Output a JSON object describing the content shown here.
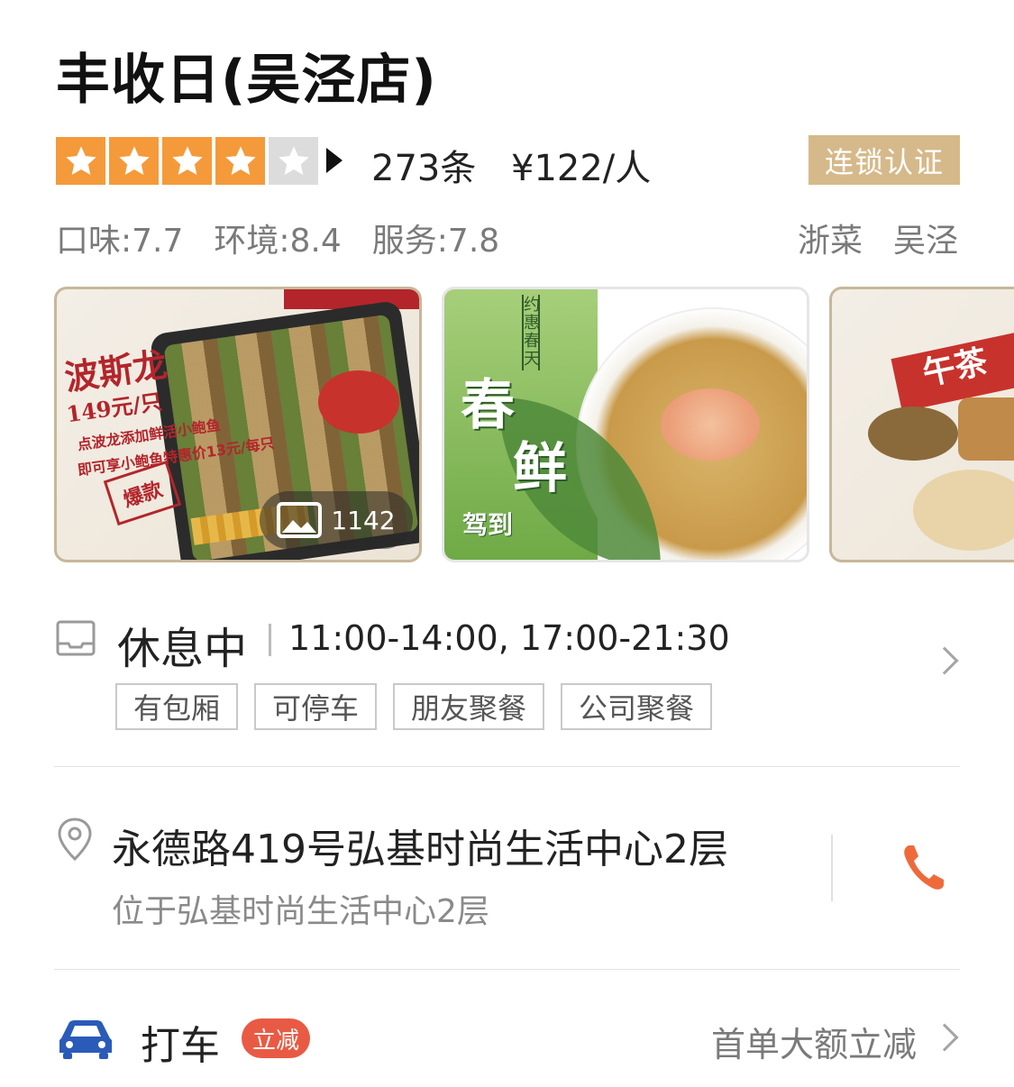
{
  "shop": {
    "title": "丰收日(吴泾店)",
    "rating_stars": 4,
    "review_count": "273条",
    "price_per_person": "¥122/人",
    "chain_badge": "连锁认证",
    "scores": [
      {
        "label": "口味:7.7"
      },
      {
        "label": "环境:8.4"
      },
      {
        "label": "服务:7.8"
      }
    ],
    "tags": [
      "浙菜",
      "吴泾"
    ]
  },
  "gallery": {
    "photo_count": "1142",
    "cards": [
      {
        "title": "波斯龙",
        "price": "149元/只",
        "line1": "点波龙添加鲜活小鲍鱼",
        "line2": "即可享小鲍鱼特惠价13元/每只",
        "stamp": "爆款"
      },
      {
        "vertical": "约惠春天",
        "big1": "春",
        "big2": "鲜",
        "bottom": "驾到"
      },
      {
        "title": "午茶"
      }
    ]
  },
  "hours": {
    "status": "休息中",
    "times": "11:00-14:00, 17:00-21:30",
    "facilities": [
      "有包厢",
      "可停车",
      "朋友聚餐",
      "公司聚餐"
    ]
  },
  "address": {
    "main": "永德路419号弘基时尚生活中心2层",
    "sub": "位于弘基时尚生活中心2层"
  },
  "taxi": {
    "label": "打车",
    "badge": "立减",
    "promo": "首单大额立减"
  },
  "colors": {
    "star": "#f59a3a",
    "badge_gold": "#d6b98a",
    "phone": "#ef6a3a",
    "car": "#2a5bb8",
    "taxi_badge": "#e95a44"
  }
}
